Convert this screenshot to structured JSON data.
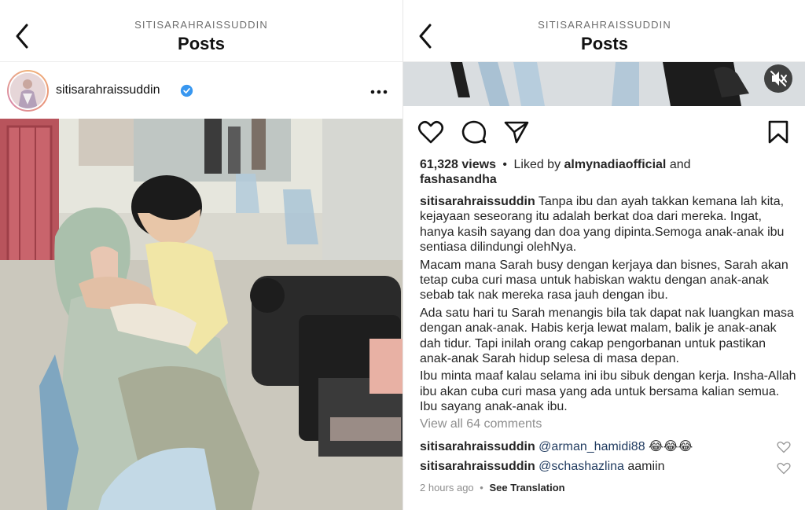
{
  "left": {
    "header": {
      "username": "SITISARAHRAISSUDDIN",
      "title": "Posts"
    },
    "profile": {
      "username": "sitisarahraissuddin",
      "verified_icon": "verified-badge-icon",
      "more_icon": "more-options-icon"
    }
  },
  "right": {
    "header": {
      "username": "SITISARAHRAISSUDDIN",
      "title": "Posts"
    },
    "views": "61,328 views",
    "liked_by_prefix": "Liked by",
    "liked_by_user": "almynadiaofficial",
    "liked_by_and": "and",
    "liked_by_user2": "fashasandha",
    "caption_user": "sitisarahraissuddin",
    "caption_p1": "Tanpa ibu dan ayah takkan kemana lah kita, kejayaan seseorang itu adalah berkat doa dari mereka. Ingat, hanya kasih sayang dan doa yang dipinta.Semoga anak-anak ibu sentiasa dilindungi olehNya.",
    "caption_p2": "Macam mana Sarah busy dengan kerjaya dan bisnes, Sarah akan tetap cuba curi masa untuk habiskan waktu dengan anak-anak sebab tak nak mereka rasa jauh dengan ibu.",
    "caption_p3": "Ada satu hari tu Sarah menangis bila tak dapat nak luangkan masa dengan anak-anak. Habis kerja lewat malam, balik je anak-anak dah tidur. Tapi inilah orang cakap pengorbanan untuk pastikan anak-anak Sarah hidup selesa di masa depan.",
    "caption_p4": "Ibu minta maaf kalau selama ini ibu sibuk dengan kerja. Insha-Allah ibu akan cuba curi masa yang ada untuk bersama kalian semua. Ibu sayang anak-anak ibu.",
    "view_all": "View all 64 comments",
    "comments": [
      {
        "user": "sitisarahraissuddin",
        "mention": "@arman_hamidi88",
        "text": "😂😂😂"
      },
      {
        "user": "sitisarahraissuddin",
        "mention": "@schashazlina",
        "text": "aamiin"
      }
    ],
    "time": "2 hours ago",
    "separator": "•",
    "see_translation": "See Translation"
  },
  "icons": [
    "back-arrow-icon",
    "heart-icon",
    "comment-icon",
    "share-icon",
    "bookmark-icon",
    "mute-icon"
  ]
}
